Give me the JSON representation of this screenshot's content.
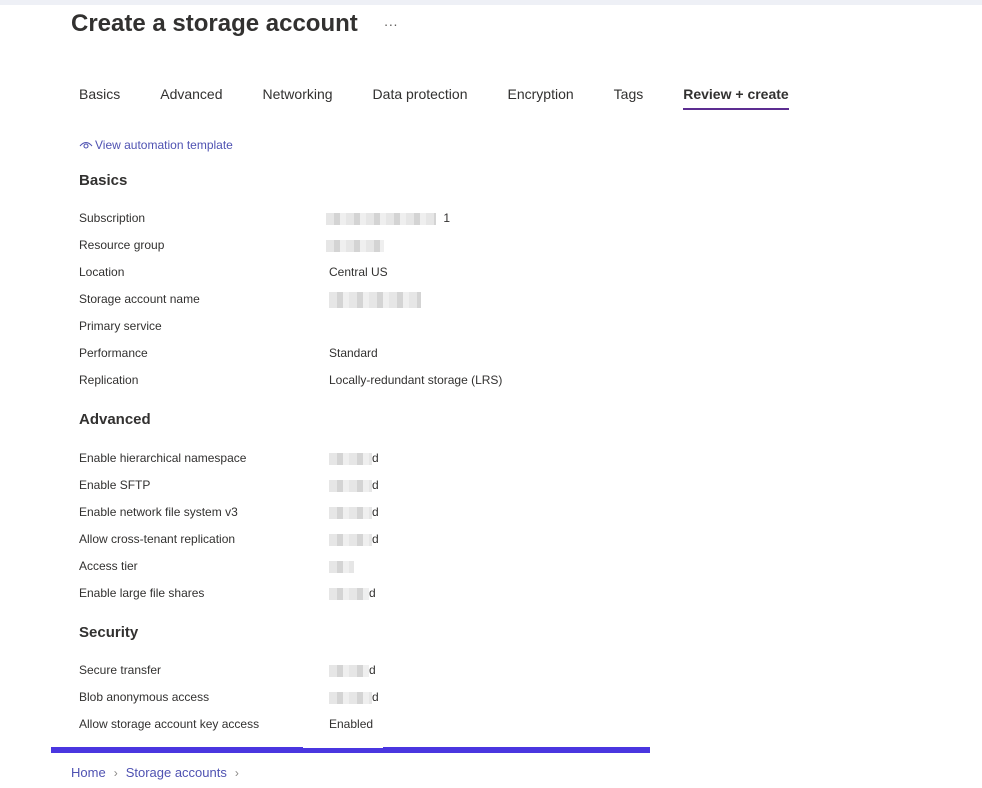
{
  "header": {
    "title": "Create a storage account",
    "more_label": "···"
  },
  "tabs": [
    {
      "label": "Basics"
    },
    {
      "label": "Advanced"
    },
    {
      "label": "Networking"
    },
    {
      "label": "Data protection"
    },
    {
      "label": "Encryption"
    },
    {
      "label": "Tags"
    },
    {
      "label": "Review + create",
      "active": true
    }
  ],
  "automation_link": {
    "label": "View automation template"
  },
  "sections": {
    "basics": {
      "heading": "Basics",
      "rows": [
        {
          "label": "Subscription",
          "value": "1",
          "redacted": true
        },
        {
          "label": "Resource group",
          "value": "",
          "redacted": true
        },
        {
          "label": "Location",
          "value": "Central US",
          "redacted": true
        },
        {
          "label": "Storage account name",
          "value": "",
          "redacted": true
        },
        {
          "label": "Primary service",
          "value": ""
        },
        {
          "label": "Performance",
          "value": "Standard"
        },
        {
          "label": "Replication",
          "value": "Locally-redundant storage (LRS)"
        }
      ]
    },
    "advanced": {
      "heading": "Advanced",
      "rows": [
        {
          "label": "Enable hierarchical namespace",
          "value": "d",
          "redacted": true
        },
        {
          "label": "Enable SFTP",
          "value": "d",
          "redacted": true
        },
        {
          "label": "Enable network file system v3",
          "value": "d",
          "redacted": true
        },
        {
          "label": "Allow cross-tenant replication",
          "value": "d",
          "redacted": true
        },
        {
          "label": "Access tier",
          "value": "",
          "redacted": true
        },
        {
          "label": "Enable large file shares",
          "value": "d",
          "redacted": true
        }
      ]
    },
    "security": {
      "heading": "Security",
      "rows": [
        {
          "label": "Secure transfer",
          "value": "d",
          "redacted": true
        },
        {
          "label": "Blob anonymous access",
          "value": "d",
          "redacted": true
        },
        {
          "label": "Allow storage account key access",
          "value": "Enabled"
        }
      ]
    }
  },
  "breadcrumb": {
    "home": "Home",
    "storage_accounts": "Storage accounts"
  },
  "colors": {
    "accent": "#5c2d91",
    "link": "#4f52b2",
    "bottom_bar": "#4a36e0"
  }
}
